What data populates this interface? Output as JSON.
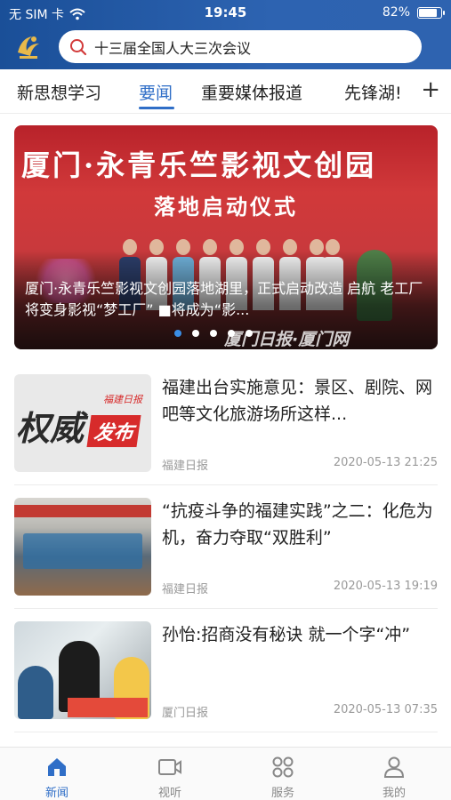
{
  "status_bar": {
    "carrier": "无 SIM 卡",
    "time": "19:45",
    "battery": "82%",
    "battery_level": 0.82
  },
  "header": {
    "logo_icon": "app-logo",
    "search": {
      "query": "十三届全国人大三次会议",
      "icon": "search-icon"
    }
  },
  "tabs": {
    "items": [
      "新思想学习",
      "要闻",
      "重要媒体报道",
      "先锋湖!"
    ],
    "active_index": 1,
    "add_icon": "plus-icon",
    "add_label": "+"
  },
  "banner": {
    "caption": "厦门·永青乐竺影视文创园落地湖里，正式启动改造 启航 老工厂 将变身影视“梦工厂” ■将成为“影...",
    "image_text_title": "厦门·永青乐竺影视文创园",
    "image_text_subtitle": "落地启动仪式",
    "watermark": "厦门日报·厦门网",
    "dots_total": 5,
    "active_dot": 0
  },
  "news": [
    {
      "title": "福建出台实施意见：景区、剧院、网吧等文化旅游场所这样...",
      "source": "福建日报",
      "time": "2020-05-13 21:25",
      "thumb_text_big": "权威",
      "thumb_text_tag": "发布",
      "thumb_text_brand": "福建日报"
    },
    {
      "title": "“抗疫斗争的福建实践”之二：化危为机，奋力夺取“双胜利”",
      "source": "福建日报",
      "time": "2020-05-13 19:19"
    },
    {
      "title": "孙怡:招商没有秘诀 就一个字“冲”",
      "source": "厦门日报",
      "time": "2020-05-13 07:35"
    }
  ],
  "bottom_nav": {
    "items": [
      {
        "label": "新闻",
        "icon": "home-icon"
      },
      {
        "label": "视听",
        "icon": "video-icon"
      },
      {
        "label": "服务",
        "icon": "grid-icon"
      },
      {
        "label": "我的",
        "icon": "user-icon"
      }
    ],
    "active_index": 0
  },
  "colors": {
    "header_blue": "#2d63b1",
    "accent": "#2f6ec7",
    "banner_red": "#c9393c"
  }
}
